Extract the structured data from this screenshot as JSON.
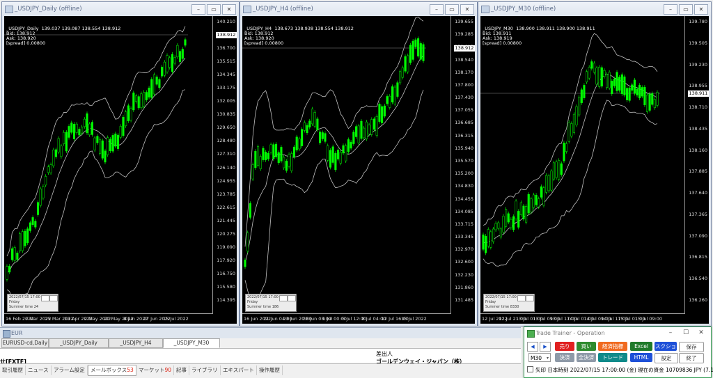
{
  "windows": [
    {
      "title": "_USDJPY_Daily (offline)",
      "ohlc_lines": [
        "_USDJPY_Daily  139.037 139.087 138.554 138.912",
        "Bid: 138.912",
        "Ask: 138.920",
        "[spread] 0.00800"
      ],
      "price_tag": "138.912",
      "y_labels": [
        "140.210",
        "137.870",
        "136.700",
        "135.515",
        "134.345",
        "133.175",
        "132.005",
        "130.835",
        "129.650",
        "128.480",
        "127.310",
        "126.140",
        "124.955",
        "123.785",
        "122.615",
        "121.445",
        "120.275",
        "119.090",
        "117.920",
        "116.750",
        "115.580",
        "114.395"
      ],
      "x_labels": [
        "16 Feb 2022",
        "7 Mar 2022",
        "25 Mar 2022",
        "13 Apr 2022",
        "2 May 2022",
        "20 May 2022",
        "8 Jun 2022",
        "27 Jun 2022",
        "15 Jul 2022"
      ],
      "info": {
        "date": "2022/07/15 17:00 (JST)",
        "day": "Friday",
        "summer": "Summer time   24"
      }
    },
    {
      "title": "_USDJPY_H4 (offline)",
      "ohlc_lines": [
        "_USDJPY_H4  138.673 138.938 138.554 138.912",
        "Bid: 138.912",
        "Ask: 138.920",
        "[spread] 0.00800"
      ],
      "price_tag": "138.912",
      "y_labels": [
        "139.655",
        "139.285",
        "138.912",
        "138.540",
        "138.170",
        "137.800",
        "137.430",
        "137.055",
        "136.685",
        "136.315",
        "135.940",
        "135.570",
        "135.200",
        "134.830",
        "134.455",
        "134.085",
        "133.715",
        "133.345",
        "132.970",
        "132.600",
        "132.230",
        "131.860",
        "131.485"
      ],
      "x_labels": [
        "16 Jun 2022",
        "21 Jun 04:00",
        "23 Jun 20:00",
        "28 Jun 08:00",
        "1 Jul 00:00",
        "5 Jul 12:00",
        "8 Jul 04:00",
        "12 Jul 16:00",
        "15 Jul 2022"
      ],
      "info": {
        "date": "2022/07/15 17:00 (JST)",
        "day": "Friday",
        "summer": "Summer time   186"
      }
    },
    {
      "title": "_USDJPY_M30 (offline)",
      "ohlc_lines": [
        "_USDJPY_M30  138.900 138.911 138.900 138.911",
        "Bid: 138.911",
        "Ask: 138.919",
        "[spread] 0.00800"
      ],
      "price_tag": "138.911",
      "y_labels": [
        "139.780",
        "139.505",
        "139.230",
        "138.955",
        "138.710",
        "138.435",
        "138.160",
        "137.885",
        "137.640",
        "137.365",
        "137.090",
        "136.815",
        "136.540",
        "136.260"
      ],
      "x_labels": [
        "12 Jul 2022",
        "12 Jul 21:00",
        "13 Jul 01:00",
        "13 Jul 09:00",
        "13 Jul 17:00",
        "14 Jul 01:00",
        "14 Jul 09:00",
        "14 Jul 17:00",
        "15 Jul 01:00",
        "15 Jul 09:00"
      ],
      "info": {
        "date": "2022/07/15 17:00 (JST)",
        "day": "Friday",
        "summer": "Summer time   8330"
      }
    }
  ],
  "terminal": {
    "title": "EUR",
    "chart_tabs": [
      "EURUSD-cd,Daily",
      "_USDJPY_Daily (offline)",
      "_USDJPY_H4 (offline)",
      "_USDJPY_M30 (offline)"
    ],
    "header_sender": "差出人",
    "row_subject": "せ[FXTF]",
    "row_sender": "ゴールデンウェイ・ジャパン（株）",
    "tabs": [
      {
        "label": "取引履歴",
        "badge": ""
      },
      {
        "label": "ニュース",
        "badge": ""
      },
      {
        "label": "アラーム設定",
        "badge": ""
      },
      {
        "label": "メールボックス",
        "badge": "53"
      },
      {
        "label": "マーケット",
        "badge": "90"
      },
      {
        "label": "記事",
        "badge": ""
      },
      {
        "label": "ライブラリ",
        "badge": ""
      },
      {
        "label": "エキスパート",
        "badge": ""
      },
      {
        "label": "操作履歴",
        "badge": ""
      }
    ]
  },
  "trade_trainer": {
    "title": "Trade Trainer - Operation",
    "buttons": {
      "sell": "売り",
      "buy": "買い",
      "econ": "経済指標",
      "excel": "Excel",
      "screenshot": "スクショ",
      "save": "保存",
      "settle": "決済",
      "settle_all": "全決済",
      "trade": "トレード",
      "html": "HTML",
      "settings": "設定",
      "exit": "終了"
    },
    "nav_prev": "◀",
    "nav_next": "▶",
    "timeframe": "M30",
    "status": "矢印  日本時刻 2022/07/15 17:00:00 (金)  現在の資金 10709836 JPY (7.1%)"
  },
  "colors": {
    "chart_bg": "#000000",
    "candle": "#00ff00",
    "band": "#c0c0c0",
    "tt_red": "#e02020",
    "tt_green": "#2e8b2e",
    "tt_blue": "#1e50d8"
  }
}
